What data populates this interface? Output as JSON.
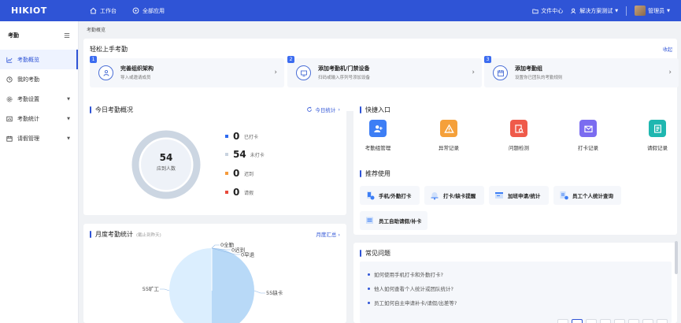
{
  "topbar": {
    "logo": "HIKIOT",
    "nav": [
      {
        "label": "工作台",
        "icon": "home-icon"
      },
      {
        "label": "全部应用",
        "icon": "apps-icon"
      }
    ],
    "doc_center": "文件中心",
    "solution": "解决方案测试",
    "user": "管理员"
  },
  "sidebar": {
    "title": "考勤",
    "items": [
      {
        "label": "考勤概览",
        "icon": "chart-icon",
        "active": true
      },
      {
        "label": "我的考勤",
        "icon": "clock-icon"
      },
      {
        "label": "考勤设置",
        "icon": "gear-icon",
        "caret": true
      },
      {
        "label": "考勤统计",
        "icon": "stats-icon",
        "caret": true
      },
      {
        "label": "请假管理",
        "icon": "calendar-icon",
        "caret": true
      }
    ]
  },
  "breadcrumb": "考勤概览",
  "quickstart": {
    "title": "轻松上手考勤",
    "collapse": "收起",
    "steps": [
      {
        "num": "1",
        "title": "完善组织架构",
        "desc": "导入或邀请成员",
        "icon": "org-icon"
      },
      {
        "num": "2",
        "title": "添加考勤机/门禁设备",
        "desc": "扫码或输入序列号添加设备",
        "icon": "device-icon"
      },
      {
        "num": "3",
        "title": "添加考勤组",
        "desc": "设置你已团队的考勤规则",
        "icon": "group-icon"
      }
    ]
  },
  "today": {
    "title": "今日考勤概况",
    "link": "今日统计",
    "total": "54",
    "total_label": "应到人数",
    "legend": [
      {
        "num": "0",
        "label": "已打卡",
        "color": "#2f6bf0"
      },
      {
        "num": "54",
        "label": "未打卡",
        "color": "#c9d3e0"
      },
      {
        "num": "0",
        "label": "迟到",
        "color": "#f59a3c"
      },
      {
        "num": "0",
        "label": "请假",
        "color": "#e84a3b"
      }
    ]
  },
  "quick": {
    "title": "快捷入口",
    "items": [
      {
        "label": "考勤组管理",
        "icon": "user-add-icon",
        "color": "#3d7ef5"
      },
      {
        "label": "异常记录",
        "icon": "warning-icon",
        "color": "#f5a03a"
      },
      {
        "label": "问题检测",
        "icon": "search-doc-icon",
        "color": "#ef5a4a"
      },
      {
        "label": "打卡记录",
        "icon": "mail-icon",
        "color": "#7b6cf0"
      },
      {
        "label": "请假记录",
        "icon": "doc-icon",
        "color": "#1fb7b0"
      }
    ]
  },
  "recommend": {
    "title": "推荐使用",
    "items": [
      {
        "label": "手机/外勤打卡",
        "icon": "phone-icon"
      },
      {
        "label": "打卡/缺卡提醒",
        "icon": "bell-icon"
      },
      {
        "label": "加班申请/统计",
        "icon": "overtime-icon"
      },
      {
        "label": "员工个人统计查询",
        "icon": "person-stat-icon"
      },
      {
        "label": "员工自助请假/补卡",
        "icon": "self-service-icon"
      }
    ]
  },
  "month": {
    "title": "月度考勤统计",
    "subtitle": "(截止到昨天)",
    "link": "月度汇总",
    "labels": {
      "full": "0全勤",
      "late": "0迟到",
      "early": "0早退",
      "missing": "55缺卡",
      "absent": "55旷工"
    },
    "colors": {
      "missing": "#b8d9f7",
      "absent": "#dbeefe"
    }
  },
  "chart_data": {
    "type": "pie",
    "categories": [
      "全勤",
      "迟到",
      "早退",
      "缺卡",
      "旷工"
    ],
    "values": [
      0,
      0,
      0,
      55,
      55
    ]
  },
  "faq": {
    "title": "常见问题",
    "items": [
      "如何使用手机打卡和外勤打卡?",
      "他人如何查看个人统计或团队统计?",
      "员工如何自主申请补卡/请假/出差等?"
    ]
  }
}
